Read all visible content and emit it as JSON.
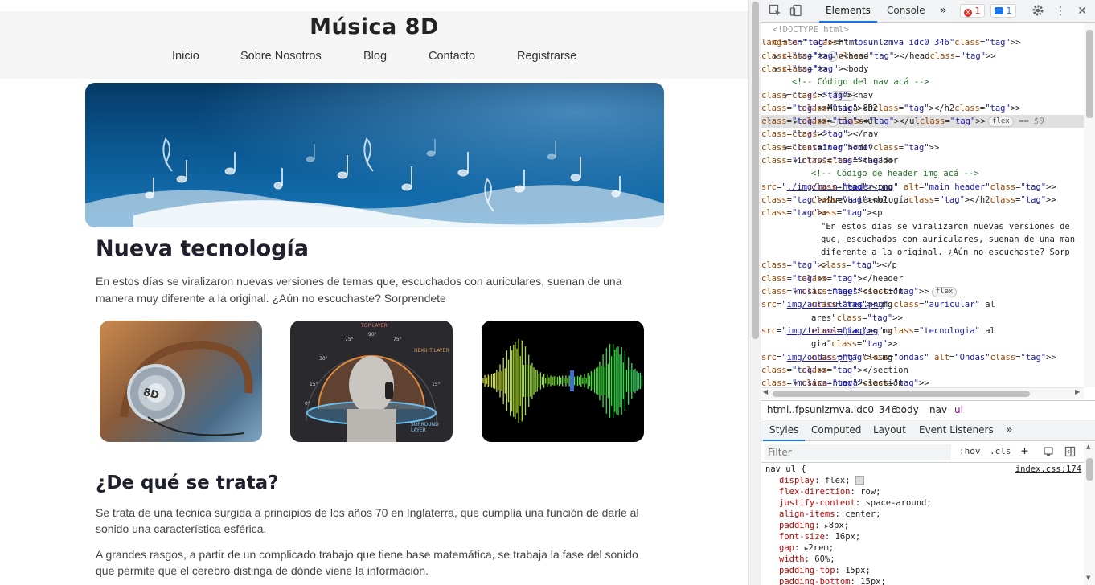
{
  "site": {
    "brand": "Música 8D",
    "nav": [
      "Inicio",
      "Sobre Nosotros",
      "Blog",
      "Contacto",
      "Registrarse"
    ],
    "intro_title": "Nueva tecnología",
    "intro_text": "En estos días se viralizaron nuevas versiones de temas que, escuchados con auriculares, suenan de una manera muy diferente a la original. ¿Aún no escuchaste? Sorprendete",
    "section_title": "¿De qué se trata?",
    "section_p1": "Se trata de una técnica surgida a principios de los años 70 en Inglaterra, que cumplía una función de darle al sonido una característica esférica.",
    "section_p2": "A grandes rasgos, a partir de un complicado trabajo que tiene base matemática, se trabaja la fase del sonido que permite que el cerebro distinga de dónde viene la información.",
    "image_texts": {
      "headphone_label": "8D",
      "dial_labels": [
        "TOP LAYER",
        "HEIGHT LAYER",
        "SURROUND LAYER",
        "75°",
        "90°",
        "75°",
        "30°",
        "15°",
        "0°",
        "15°"
      ]
    }
  },
  "devtools": {
    "tabs": [
      "Elements",
      "Console"
    ],
    "more_tabs": "»",
    "error_count": "1",
    "message_count": "1",
    "dom_lines": [
      {
        "indent": 0,
        "html": "<!DOCTYPE html>",
        "kind": "doctype"
      },
      {
        "indent": 0,
        "text": "<html lang=\"en\" class=\" fpsunlzmva idc0_346\">"
      },
      {
        "indent": 1,
        "text": "<head>…</head>",
        "collapsed": true
      },
      {
        "indent": 1,
        "text": "<body>",
        "open": true
      },
      {
        "indent": 2,
        "text": "<!-- Código del nav acá -->",
        "comment": true
      },
      {
        "indent": 2,
        "text": "<nav>",
        "open": true,
        "pill": "flex"
      },
      {
        "indent": 3,
        "text": "<h2>Música 8D</h2>"
      },
      {
        "indent": 3,
        "text": "<ul>…</ul>",
        "collapsed": true,
        "pill": "flex",
        "selected": true,
        "suffix": "== $0"
      },
      {
        "indent": 2,
        "text": "</nav>"
      },
      {
        "indent": 2,
        "text": "<div class=\"container home\">",
        "open": true
      },
      {
        "indent": 3,
        "text": "<header class=\"intro\">",
        "open": true
      },
      {
        "indent": 4,
        "text": "<!-- Código de header img acá -->",
        "comment": true
      },
      {
        "indent": 4,
        "text": "<img src=\"./img/main-header.png\" alt=\"main header\">"
      },
      {
        "indent": 4,
        "text": "<h2>Nueva tecnología</h2>"
      },
      {
        "indent": 4,
        "text": "<p>",
        "open": true
      },
      {
        "indent": 5,
        "text": "\"En estos días se viralizaron nuevas versiones de"
      },
      {
        "indent": 5,
        "text": "que, escuchados con auriculares, suenan de una man"
      },
      {
        "indent": 5,
        "text": "diferente a la original. ¿Aún no escuchaste? Sorp"
      },
      {
        "indent": 5,
        "text": "</p>"
      },
      {
        "indent": 3,
        "text": "</header>"
      },
      {
        "indent": 3,
        "text": "<section class=\"music-images\">",
        "open": true,
        "pill": "flex"
      },
      {
        "indent": 4,
        "text": "<img src=\"img/auriculares.png\" class=\"auricular\" al"
      },
      {
        "indent": 4,
        "text": "ares\">"
      },
      {
        "indent": 4,
        "text": "<img src=\"img/tecnologia.png\" class=\"tecnologia\" al"
      },
      {
        "indent": 4,
        "text": "gia\">"
      },
      {
        "indent": 4,
        "text": "<img src=\"img/ondas.png\" class=\"ondas\" alt=\"Ondas\">"
      },
      {
        "indent": 3,
        "text": "</section>"
      },
      {
        "indent": 3,
        "text": "<section class=\"musica-nueva\">",
        "open": true
      }
    ],
    "breadcrumbs": [
      "html..fpsunlzmva.idc0_346",
      "body",
      "nav",
      "ul"
    ],
    "sub_tabs": [
      "Styles",
      "Computed",
      "Layout",
      "Event Listeners"
    ],
    "filter_placeholder": "Filter",
    "hov_label": ":hov",
    "cls_label": ".cls",
    "rule_selector": "nav ul {",
    "rule_source": "index.css:174",
    "rule_props": [
      {
        "name": "display",
        "value": "flex;",
        "icon": true
      },
      {
        "name": "flex-direction",
        "value": "row;"
      },
      {
        "name": "justify-content",
        "value": "space-around;"
      },
      {
        "name": "align-items",
        "value": "center;"
      },
      {
        "name": "padding",
        "value": "8px;",
        "expand": true
      },
      {
        "name": "font-size",
        "value": "16px;"
      },
      {
        "name": "gap",
        "value": "2rem;",
        "expand": true
      },
      {
        "name": "width",
        "value": "60%;"
      },
      {
        "name": "padding-top",
        "value": "15px;"
      },
      {
        "name": "padding-bottom",
        "value": "15px;"
      }
    ],
    "colors": {
      "accent": "#1a73e8",
      "tag": "#881280",
      "attr": "#994500",
      "value": "#1a1aa6",
      "comment": "#236e25",
      "prop": "#c80000"
    }
  }
}
